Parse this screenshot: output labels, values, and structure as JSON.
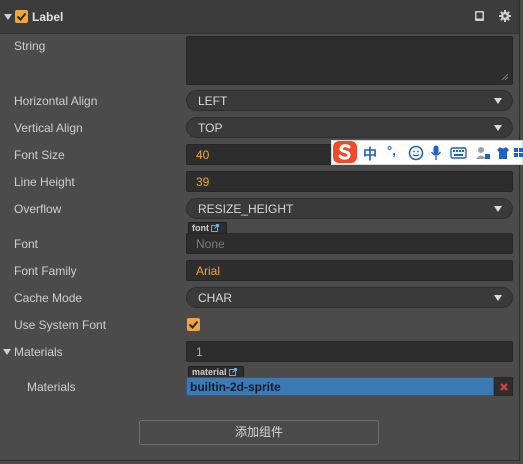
{
  "header": {
    "title": "Label",
    "enabled": true
  },
  "rows": {
    "string": {
      "label": "String",
      "value": ""
    },
    "h_align": {
      "label": "Horizontal Align",
      "value": "LEFT"
    },
    "v_align": {
      "label": "Vertical Align",
      "value": "TOP"
    },
    "font_size": {
      "label": "Font Size",
      "value": "40"
    },
    "line_height": {
      "label": "Line Height",
      "value": "39"
    },
    "overflow": {
      "label": "Overflow",
      "value": "RESIZE_HEIGHT"
    },
    "font": {
      "label": "Font",
      "tag": "font",
      "value": "None"
    },
    "font_family": {
      "label": "Font Family",
      "value": "Arial"
    },
    "cache_mode": {
      "label": "Cache Mode",
      "value": "CHAR"
    },
    "use_system_font": {
      "label": "Use System Font",
      "checked": true
    },
    "materials": {
      "label": "Materials",
      "count": "1"
    },
    "material_item": {
      "label": "Materials",
      "tag": "material",
      "value": "builtin-2d-sprite"
    }
  },
  "add_component_label": "添加组件",
  "ime": {
    "chinese_char": "中",
    "punct": "°,"
  },
  "colors": {
    "accent": "#f3a43b",
    "asset_bg": "#3d7ab4",
    "remove": "#e04040"
  }
}
